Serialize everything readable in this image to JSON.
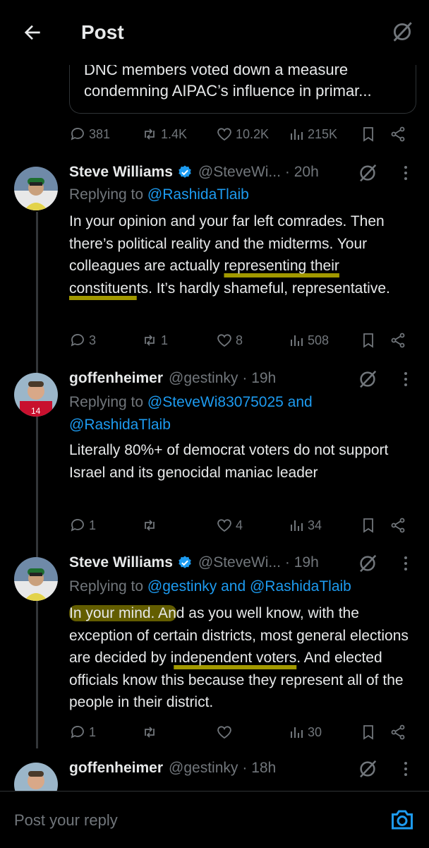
{
  "header": {
    "title": "Post"
  },
  "quote": {
    "text": "DNC members voted down a measure condemning AIPAC’s influence in primar..."
  },
  "main_actions": {
    "replies": "381",
    "reposts": "1.4K",
    "likes": "10.2K",
    "views": "215K"
  },
  "tweets": [
    {
      "name": "Steve Williams",
      "handle": "@SteveWi...",
      "time": "· 20h",
      "replying_prefix": "Replying to",
      "replying_to": "@RashidaTlaib",
      "body_1": "In your opinion and your far left comrades. Then there’s political reality and the midterms. Your colleagues are actually ",
      "body_hl": "representing their constituen",
      "body_2": "ts. It’s hardly shameful, representative.",
      "replies": "3",
      "reposts": "1",
      "likes": "8",
      "views": "508"
    },
    {
      "name": "goffenheimer",
      "handle": "@gestinky",
      "time": "· 19h",
      "replying_prefix": "Replying to",
      "replying_to": "@SteveWi83075025 and",
      "replying_to_2": "@RashidaTlaib",
      "body": "Literally 80%+ of democrat voters do not support Israel and its genocidal maniac leader",
      "replies": "1",
      "reposts": "",
      "likes": "4",
      "views": "34"
    },
    {
      "name": "Steve Williams",
      "handle": "@SteveWi...",
      "time": "· 19h",
      "replying_prefix": "Replying to",
      "replying_to": "@gestinky and @RashidaTlaib",
      "body_hl1": "In your mind. An",
      "body_1": "d as you well know, with the exception of certain districts, most general elections are decided by i",
      "body_hl2": "ndependent voters",
      "body_2": ". And elected officials know this because they represent all of the people in their district.",
      "replies": "1",
      "reposts": "",
      "likes": "",
      "views": "30"
    },
    {
      "name": "goffenheimer",
      "handle": "@gestinky",
      "time": "· 18h"
    }
  ],
  "reply_box": {
    "placeholder": "Post your reply"
  },
  "colors": {
    "background": "#000000",
    "text": "#e7e9ea",
    "muted": "#71767b",
    "link": "#1d9bf0",
    "verified": "#1d9bf0"
  }
}
